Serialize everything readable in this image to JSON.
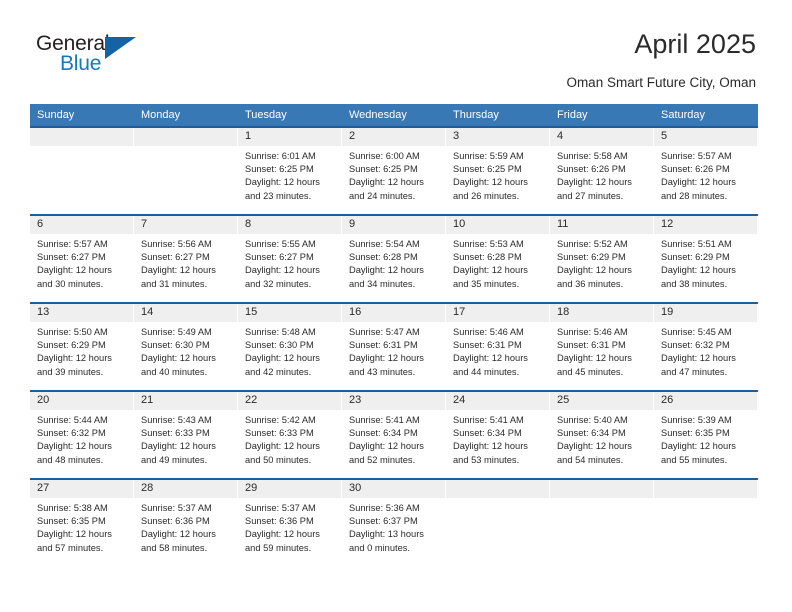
{
  "brand": {
    "word_one": "General",
    "word_two": "Blue",
    "accent_color": "#1878be",
    "triangle_color": "#1464a5"
  },
  "header": {
    "title": "April 2025",
    "subtitle": "Oman Smart Future City, Oman"
  },
  "theme": {
    "header_row_bg": "#3878b4",
    "week_divider": "#1f5c99",
    "date_band_bg": "#efefef",
    "text_color": "#2b2b2b"
  },
  "weekdays": [
    "Sunday",
    "Monday",
    "Tuesday",
    "Wednesday",
    "Thursday",
    "Friday",
    "Saturday"
  ],
  "weeks": [
    [
      {
        "day": "",
        "sunrise": "",
        "sunset": "",
        "daylight_1": "",
        "daylight_2": ""
      },
      {
        "day": "",
        "sunrise": "",
        "sunset": "",
        "daylight_1": "",
        "daylight_2": ""
      },
      {
        "day": "1",
        "sunrise": "Sunrise: 6:01 AM",
        "sunset": "Sunset: 6:25 PM",
        "daylight_1": "Daylight: 12 hours",
        "daylight_2": "and 23 minutes."
      },
      {
        "day": "2",
        "sunrise": "Sunrise: 6:00 AM",
        "sunset": "Sunset: 6:25 PM",
        "daylight_1": "Daylight: 12 hours",
        "daylight_2": "and 24 minutes."
      },
      {
        "day": "3",
        "sunrise": "Sunrise: 5:59 AM",
        "sunset": "Sunset: 6:25 PM",
        "daylight_1": "Daylight: 12 hours",
        "daylight_2": "and 26 minutes."
      },
      {
        "day": "4",
        "sunrise": "Sunrise: 5:58 AM",
        "sunset": "Sunset: 6:26 PM",
        "daylight_1": "Daylight: 12 hours",
        "daylight_2": "and 27 minutes."
      },
      {
        "day": "5",
        "sunrise": "Sunrise: 5:57 AM",
        "sunset": "Sunset: 6:26 PM",
        "daylight_1": "Daylight: 12 hours",
        "daylight_2": "and 28 minutes."
      }
    ],
    [
      {
        "day": "6",
        "sunrise": "Sunrise: 5:57 AM",
        "sunset": "Sunset: 6:27 PM",
        "daylight_1": "Daylight: 12 hours",
        "daylight_2": "and 30 minutes."
      },
      {
        "day": "7",
        "sunrise": "Sunrise: 5:56 AM",
        "sunset": "Sunset: 6:27 PM",
        "daylight_1": "Daylight: 12 hours",
        "daylight_2": "and 31 minutes."
      },
      {
        "day": "8",
        "sunrise": "Sunrise: 5:55 AM",
        "sunset": "Sunset: 6:27 PM",
        "daylight_1": "Daylight: 12 hours",
        "daylight_2": "and 32 minutes."
      },
      {
        "day": "9",
        "sunrise": "Sunrise: 5:54 AM",
        "sunset": "Sunset: 6:28 PM",
        "daylight_1": "Daylight: 12 hours",
        "daylight_2": "and 34 minutes."
      },
      {
        "day": "10",
        "sunrise": "Sunrise: 5:53 AM",
        "sunset": "Sunset: 6:28 PM",
        "daylight_1": "Daylight: 12 hours",
        "daylight_2": "and 35 minutes."
      },
      {
        "day": "11",
        "sunrise": "Sunrise: 5:52 AM",
        "sunset": "Sunset: 6:29 PM",
        "daylight_1": "Daylight: 12 hours",
        "daylight_2": "and 36 minutes."
      },
      {
        "day": "12",
        "sunrise": "Sunrise: 5:51 AM",
        "sunset": "Sunset: 6:29 PM",
        "daylight_1": "Daylight: 12 hours",
        "daylight_2": "and 38 minutes."
      }
    ],
    [
      {
        "day": "13",
        "sunrise": "Sunrise: 5:50 AM",
        "sunset": "Sunset: 6:29 PM",
        "daylight_1": "Daylight: 12 hours",
        "daylight_2": "and 39 minutes."
      },
      {
        "day": "14",
        "sunrise": "Sunrise: 5:49 AM",
        "sunset": "Sunset: 6:30 PM",
        "daylight_1": "Daylight: 12 hours",
        "daylight_2": "and 40 minutes."
      },
      {
        "day": "15",
        "sunrise": "Sunrise: 5:48 AM",
        "sunset": "Sunset: 6:30 PM",
        "daylight_1": "Daylight: 12 hours",
        "daylight_2": "and 42 minutes."
      },
      {
        "day": "16",
        "sunrise": "Sunrise: 5:47 AM",
        "sunset": "Sunset: 6:31 PM",
        "daylight_1": "Daylight: 12 hours",
        "daylight_2": "and 43 minutes."
      },
      {
        "day": "17",
        "sunrise": "Sunrise: 5:46 AM",
        "sunset": "Sunset: 6:31 PM",
        "daylight_1": "Daylight: 12 hours",
        "daylight_2": "and 44 minutes."
      },
      {
        "day": "18",
        "sunrise": "Sunrise: 5:46 AM",
        "sunset": "Sunset: 6:31 PM",
        "daylight_1": "Daylight: 12 hours",
        "daylight_2": "and 45 minutes."
      },
      {
        "day": "19",
        "sunrise": "Sunrise: 5:45 AM",
        "sunset": "Sunset: 6:32 PM",
        "daylight_1": "Daylight: 12 hours",
        "daylight_2": "and 47 minutes."
      }
    ],
    [
      {
        "day": "20",
        "sunrise": "Sunrise: 5:44 AM",
        "sunset": "Sunset: 6:32 PM",
        "daylight_1": "Daylight: 12 hours",
        "daylight_2": "and 48 minutes."
      },
      {
        "day": "21",
        "sunrise": "Sunrise: 5:43 AM",
        "sunset": "Sunset: 6:33 PM",
        "daylight_1": "Daylight: 12 hours",
        "daylight_2": "and 49 minutes."
      },
      {
        "day": "22",
        "sunrise": "Sunrise: 5:42 AM",
        "sunset": "Sunset: 6:33 PM",
        "daylight_1": "Daylight: 12 hours",
        "daylight_2": "and 50 minutes."
      },
      {
        "day": "23",
        "sunrise": "Sunrise: 5:41 AM",
        "sunset": "Sunset: 6:34 PM",
        "daylight_1": "Daylight: 12 hours",
        "daylight_2": "and 52 minutes."
      },
      {
        "day": "24",
        "sunrise": "Sunrise: 5:41 AM",
        "sunset": "Sunset: 6:34 PM",
        "daylight_1": "Daylight: 12 hours",
        "daylight_2": "and 53 minutes."
      },
      {
        "day": "25",
        "sunrise": "Sunrise: 5:40 AM",
        "sunset": "Sunset: 6:34 PM",
        "daylight_1": "Daylight: 12 hours",
        "daylight_2": "and 54 minutes."
      },
      {
        "day": "26",
        "sunrise": "Sunrise: 5:39 AM",
        "sunset": "Sunset: 6:35 PM",
        "daylight_1": "Daylight: 12 hours",
        "daylight_2": "and 55 minutes."
      }
    ],
    [
      {
        "day": "27",
        "sunrise": "Sunrise: 5:38 AM",
        "sunset": "Sunset: 6:35 PM",
        "daylight_1": "Daylight: 12 hours",
        "daylight_2": "and 57 minutes."
      },
      {
        "day": "28",
        "sunrise": "Sunrise: 5:37 AM",
        "sunset": "Sunset: 6:36 PM",
        "daylight_1": "Daylight: 12 hours",
        "daylight_2": "and 58 minutes."
      },
      {
        "day": "29",
        "sunrise": "Sunrise: 5:37 AM",
        "sunset": "Sunset: 6:36 PM",
        "daylight_1": "Daylight: 12 hours",
        "daylight_2": "and 59 minutes."
      },
      {
        "day": "30",
        "sunrise": "Sunrise: 5:36 AM",
        "sunset": "Sunset: 6:37 PM",
        "daylight_1": "Daylight: 13 hours",
        "daylight_2": "and 0 minutes."
      },
      {
        "day": "",
        "sunrise": "",
        "sunset": "",
        "daylight_1": "",
        "daylight_2": ""
      },
      {
        "day": "",
        "sunrise": "",
        "sunset": "",
        "daylight_1": "",
        "daylight_2": ""
      },
      {
        "day": "",
        "sunrise": "",
        "sunset": "",
        "daylight_1": "",
        "daylight_2": ""
      }
    ]
  ]
}
